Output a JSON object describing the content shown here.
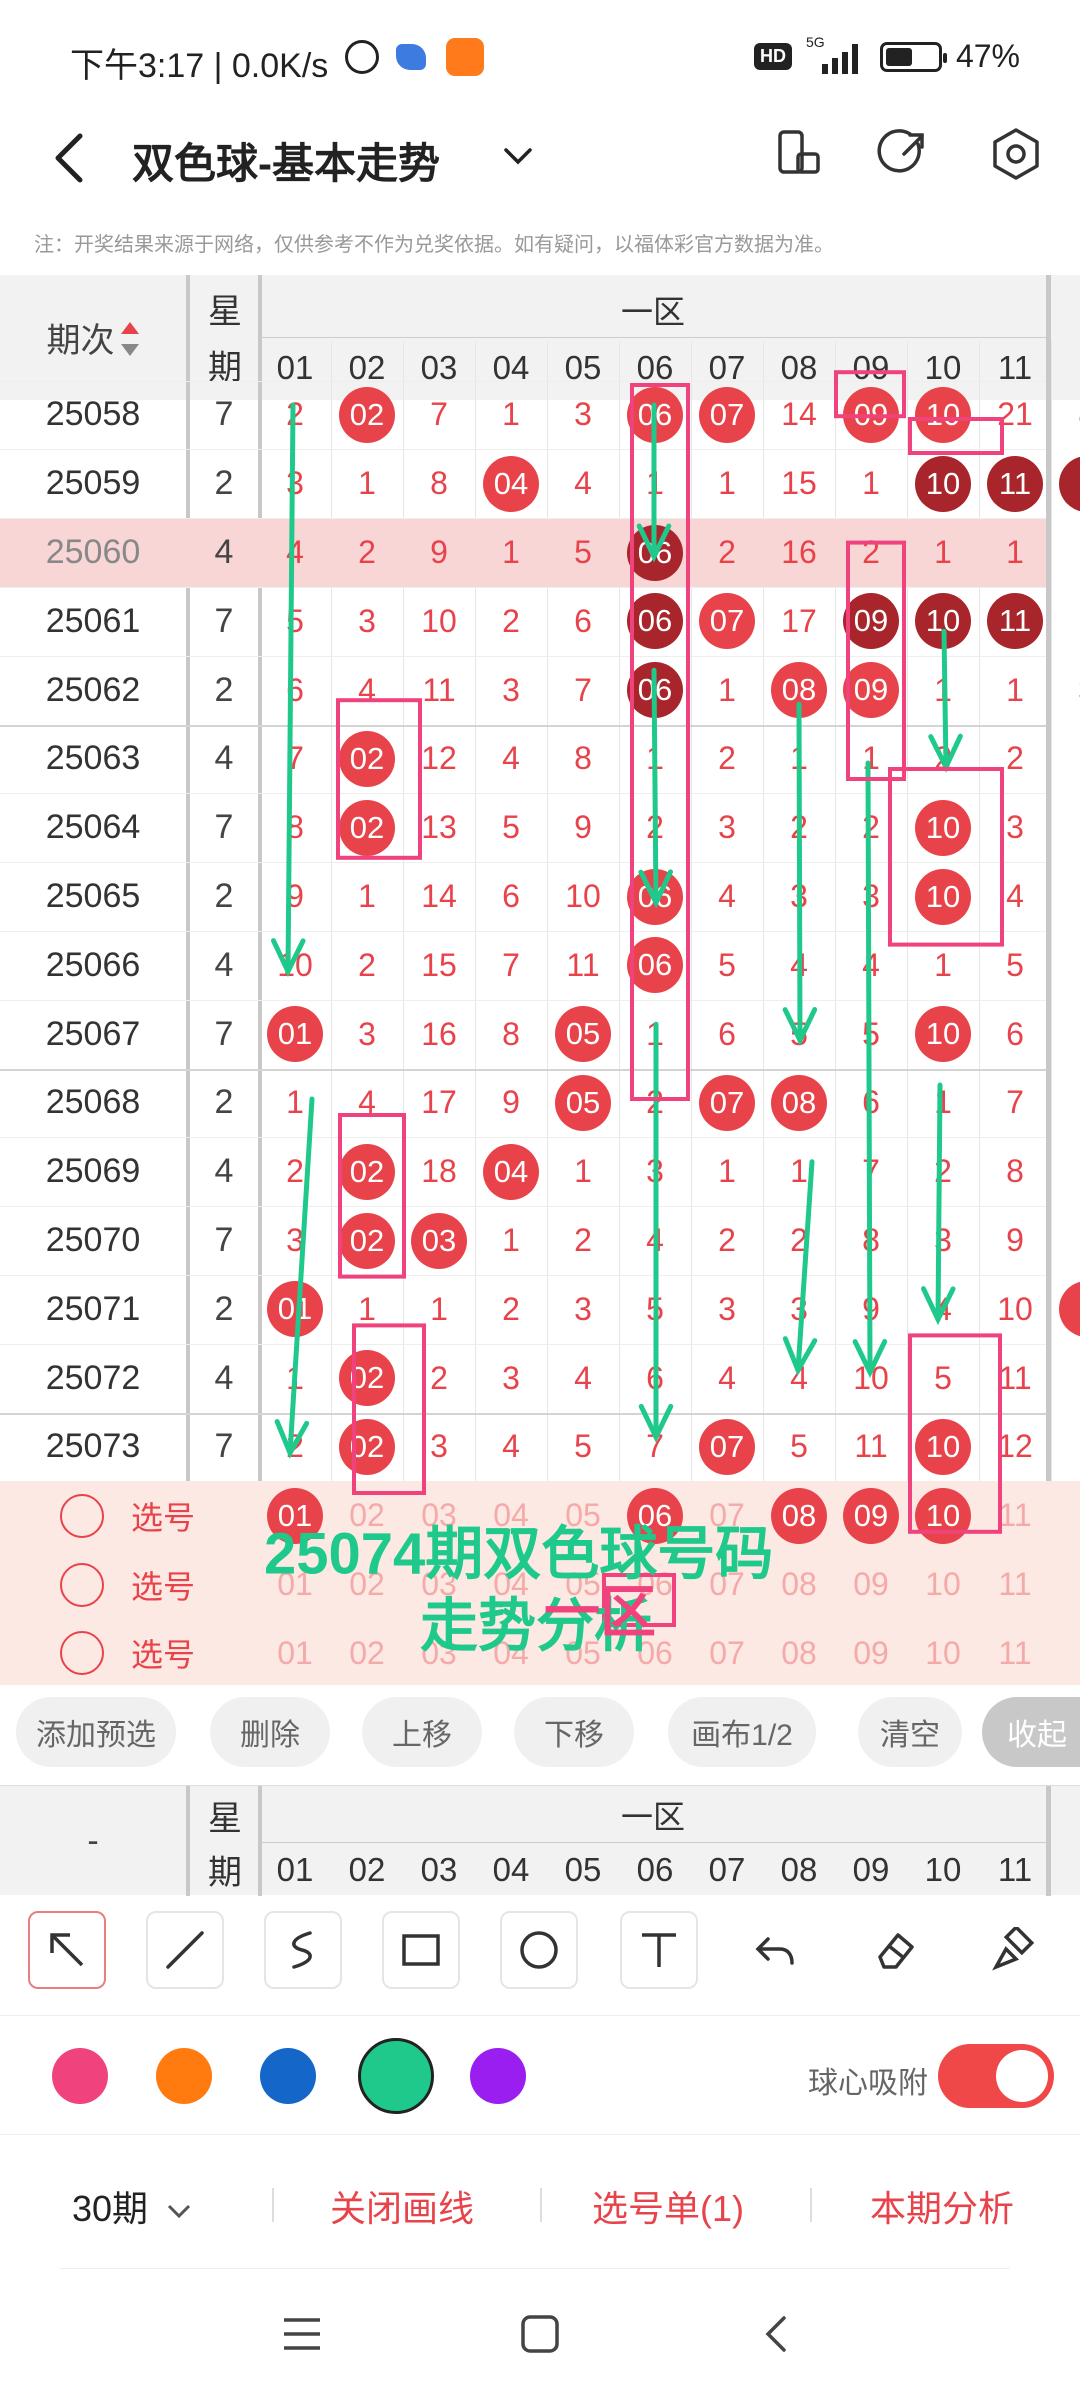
{
  "status": {
    "time": "下午3:17 | 0.0K/s",
    "hd": "HD",
    "net": "5G",
    "battery": "47%",
    "battery_level": 0.47
  },
  "header": {
    "title": "双色球-基本走势",
    "notice": "注：开奖结果来源于网络，仅供参考不作为兑奖依据。如有疑问，以福体彩官方数据为准。"
  },
  "table": {
    "issue_header": "期次",
    "week_header_top": "星",
    "week_header_bottom": "期",
    "zone_label": "一区",
    "columns": [
      "01",
      "02",
      "03",
      "04",
      "05",
      "06",
      "07",
      "08",
      "09",
      "10",
      "11",
      "1"
    ],
    "rows": [
      {
        "issue": "25058",
        "week": "7",
        "cells": [
          "2",
          "02",
          "7",
          "1",
          "3",
          "06",
          "07",
          "14",
          "09",
          "10",
          "21",
          "8"
        ],
        "balls": [
          1,
          5,
          6,
          8,
          9
        ]
      },
      {
        "issue": "25059",
        "week": "2",
        "cells": [
          "3",
          "1",
          "8",
          "04",
          "4",
          "1",
          "1",
          "15",
          "1",
          "10",
          "11",
          "1"
        ],
        "balls": [
          3,
          9,
          10,
          11
        ],
        "dark": [
          9,
          10,
          11
        ]
      },
      {
        "issue": "25060",
        "week": "4",
        "cells": [
          "4",
          "2",
          "9",
          "1",
          "5",
          "06",
          "2",
          "16",
          "2",
          "1",
          "1",
          ""
        ],
        "balls": [
          5
        ],
        "dark": [
          5
        ],
        "highlight": true
      },
      {
        "issue": "25061",
        "week": "7",
        "cells": [
          "5",
          "3",
          "10",
          "2",
          "6",
          "06",
          "07",
          "17",
          "09",
          "10",
          "11",
          ""
        ],
        "balls": [
          5,
          6,
          8,
          9,
          10
        ],
        "dark": [
          5,
          8,
          9,
          10
        ]
      },
      {
        "issue": "25062",
        "week": "2",
        "cells": [
          "6",
          "4",
          "11",
          "3",
          "7",
          "06",
          "1",
          "08",
          "09",
          "1",
          "1",
          "3"
        ],
        "balls": [
          5,
          7,
          8
        ],
        "dark": [
          5
        ]
      },
      {
        "issue": "25063",
        "week": "4",
        "cells": [
          "7",
          "02",
          "12",
          "4",
          "8",
          "1",
          "2",
          "1",
          "1",
          "2",
          "2",
          ""
        ],
        "balls": [
          1
        ]
      },
      {
        "issue": "25064",
        "week": "7",
        "cells": [
          "8",
          "02",
          "13",
          "5",
          "9",
          "2",
          "3",
          "2",
          "2",
          "10",
          "3",
          ""
        ],
        "balls": [
          1,
          9
        ]
      },
      {
        "issue": "25065",
        "week": "2",
        "cells": [
          "9",
          "1",
          "14",
          "6",
          "10",
          "06",
          "4",
          "3",
          "3",
          "10",
          "4",
          ""
        ],
        "balls": [
          5,
          9
        ]
      },
      {
        "issue": "25066",
        "week": "4",
        "cells": [
          "10",
          "2",
          "15",
          "7",
          "11",
          "06",
          "5",
          "4",
          "4",
          "1",
          "5",
          ""
        ],
        "balls": [
          5
        ]
      },
      {
        "issue": "25067",
        "week": "7",
        "cells": [
          "01",
          "3",
          "16",
          "8",
          "05",
          "1",
          "6",
          "5",
          "5",
          "10",
          "6",
          ""
        ],
        "balls": [
          0,
          4,
          9
        ]
      },
      {
        "issue": "25068",
        "week": "2",
        "cells": [
          "1",
          "4",
          "17",
          "9",
          "05",
          "2",
          "07",
          "08",
          "6",
          "1",
          "7",
          ""
        ],
        "balls": [
          4,
          6,
          7
        ]
      },
      {
        "issue": "25069",
        "week": "4",
        "cells": [
          "2",
          "02",
          "18",
          "04",
          "1",
          "3",
          "1",
          "1",
          "7",
          "2",
          "8",
          "1"
        ],
        "balls": [
          1,
          3
        ]
      },
      {
        "issue": "25070",
        "week": "7",
        "cells": [
          "3",
          "02",
          "03",
          "1",
          "2",
          "4",
          "2",
          "2",
          "8",
          "3",
          "9",
          "1"
        ],
        "balls": [
          1,
          2
        ]
      },
      {
        "issue": "25071",
        "week": "2",
        "cells": [
          "01",
          "1",
          "1",
          "2",
          "3",
          "5",
          "3",
          "3",
          "9",
          "4",
          "10",
          "1"
        ],
        "balls": [
          0,
          11
        ]
      },
      {
        "issue": "25072",
        "week": "4",
        "cells": [
          "1",
          "02",
          "2",
          "3",
          "4",
          "6",
          "4",
          "4",
          "10",
          "5",
          "11",
          ""
        ],
        "balls": [
          1
        ]
      },
      {
        "issue": "25073",
        "week": "7",
        "cells": [
          "2",
          "02",
          "3",
          "4",
          "5",
          "7",
          "07",
          "5",
          "11",
          "10",
          "12",
          ""
        ],
        "balls": [
          1,
          6,
          9
        ]
      }
    ],
    "pick_label": "选号",
    "pick_rows": [
      {
        "cells": [
          "01",
          "02",
          "03",
          "04",
          "05",
          "06",
          "07",
          "08",
          "09",
          "10",
          "11",
          "1"
        ],
        "balls": [
          0,
          5,
          7,
          8,
          9
        ]
      },
      {
        "cells": [
          "01",
          "02",
          "03",
          "04",
          "05",
          "06",
          "07",
          "08",
          "09",
          "10",
          "11",
          "1"
        ],
        "balls": []
      },
      {
        "cells": [
          "01",
          "02",
          "03",
          "04",
          "05",
          "06",
          "07",
          "08",
          "09",
          "10",
          "11",
          "1"
        ],
        "balls": []
      }
    ],
    "overlay_text_line1": "25074期双色球号码",
    "overlay_text_line2": "走势分析",
    "overlay_zone_text": "一区"
  },
  "actions": [
    "添加预选",
    "删除",
    "上移",
    "下移",
    "画布1/2",
    "清空",
    "收起"
  ],
  "sticky_header": {
    "issue_header": "-",
    "week_top": "星",
    "week_bottom": "期",
    "zone_label": "一区",
    "columns": [
      "01",
      "02",
      "03",
      "04",
      "05",
      "06",
      "07",
      "08",
      "09",
      "10",
      "11",
      "1"
    ]
  },
  "tools": [
    "pointer-tool",
    "line-tool",
    "curve-tool",
    "rectangle-tool",
    "circle-tool",
    "text-tool",
    "undo-tool",
    "eraser-tool",
    "clear-brush-tool"
  ],
  "colors": {
    "pink": "#f0437d",
    "orange": "#ff7a0f",
    "blue": "#1466c8",
    "green": "#1ec98b",
    "purple": "#9b1ef0",
    "accent_red": "#e8434a"
  },
  "snap_label": "球心吸附",
  "bottom": {
    "period": "30期",
    "close_lines": "关闭画线",
    "pick_list": "选号单(1)",
    "analysis": "本期分析"
  }
}
